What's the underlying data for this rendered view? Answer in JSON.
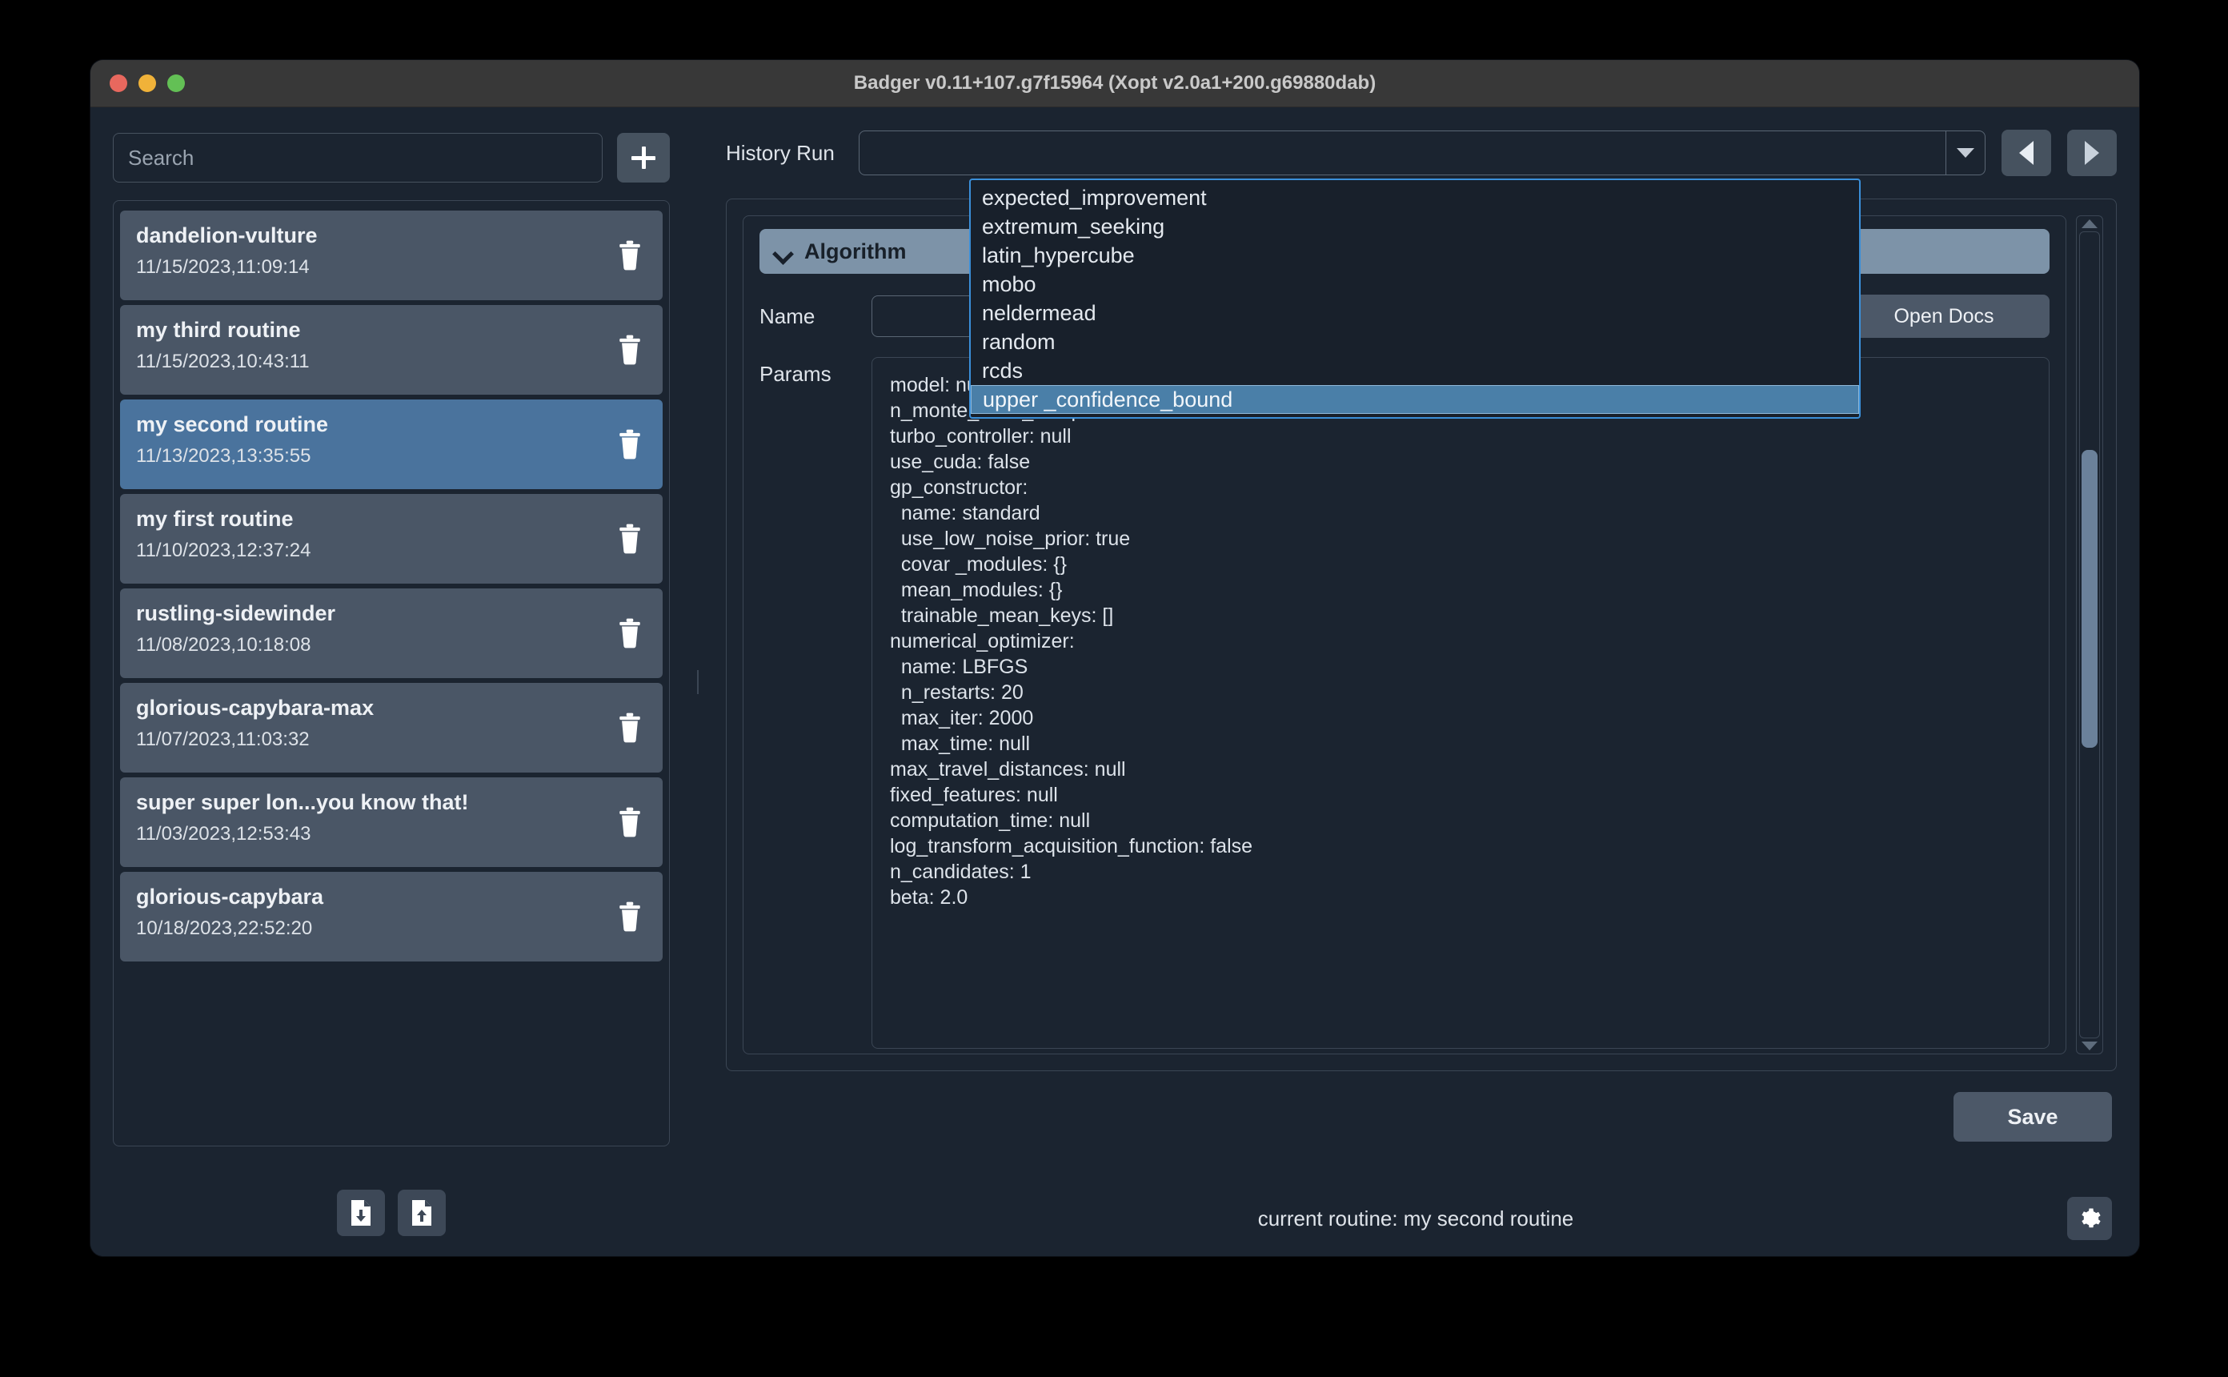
{
  "window": {
    "title": "Badger v0.11+107.g7f15964 (Xopt v2.0a1+200.g69880dab)",
    "traffic": {
      "close": "close-button",
      "minimize": "minimize-button",
      "zoom": "zoom-button"
    }
  },
  "sidebar": {
    "search": {
      "placeholder": "Search",
      "value": ""
    },
    "add_label": "+",
    "routines": [
      {
        "name": "dandelion-vulture",
        "time": "11/15/2023,11:09:14",
        "selected": false
      },
      {
        "name": "my third routine",
        "time": "11/15/2023,10:43:11",
        "selected": false
      },
      {
        "name": "my second routine",
        "time": "11/13/2023,13:35:55",
        "selected": true
      },
      {
        "name": "my first routine",
        "time": "11/10/2023,12:37:24",
        "selected": false
      },
      {
        "name": "rustling-sidewinder",
        "time": "11/08/2023,10:18:08",
        "selected": false
      },
      {
        "name": "glorious-capybara-max",
        "time": "11/07/2023,11:03:32",
        "selected": false
      },
      {
        "name": "super super lon...you know that!",
        "time": "11/03/2023,12:53:43",
        "selected": false
      },
      {
        "name": "glorious-capybara",
        "time": "10/18/2023,22:52:20",
        "selected": false
      }
    ],
    "footer": {
      "import_icon": "file-download-icon",
      "export_icon": "file-upload-icon"
    }
  },
  "main": {
    "history_label": "History Run",
    "history_value": "",
    "prev_icon": "triangle-left-icon",
    "next_icon": "triangle-right-icon",
    "group_title": "Algorithm",
    "name_label": "Name",
    "name_value": "",
    "open_docs_label": "Open Docs",
    "params_label": "Params",
    "params_text": "model: null\nn_monte_carlo_samples: 128\nturbo_controller: null\nuse_cuda: false\ngp_constructor:\n  name: standard\n  use_low_noise_prior: true\n  covar _modules: {}\n  mean_modules: {}\n  trainable_mean_keys: []\nnumerical_optimizer:\n  name: LBFGS\n  n_restarts: 20\n  max_iter: 2000\n  max_time: null\nmax_travel_distances: null\nfixed_features: null\ncomputation_time: null\nlog_transform_acquisition_function: false\nn_candidates: 1\nbeta: 2.0",
    "save_label": "Save"
  },
  "dropdown": {
    "open": true,
    "items": [
      "expected_improvement",
      "extremum_seeking",
      "latin_hypercube",
      "mobo",
      "neldermead",
      "random",
      "rcds",
      "upper _confidence_bound"
    ],
    "selected": "upper _confidence_bound"
  },
  "statusbar": {
    "text": "current routine: my second routine",
    "settings_icon": "gear-icon"
  },
  "colors": {
    "window_bg": "#1b2430",
    "titlebar": "#383838",
    "accent_selected": "#4a739d",
    "item_bg": "#4a5666",
    "dropdown_highlight": "#4a7fa8",
    "focus_border": "#3a8fd9",
    "group_header": "#7d93a8"
  }
}
